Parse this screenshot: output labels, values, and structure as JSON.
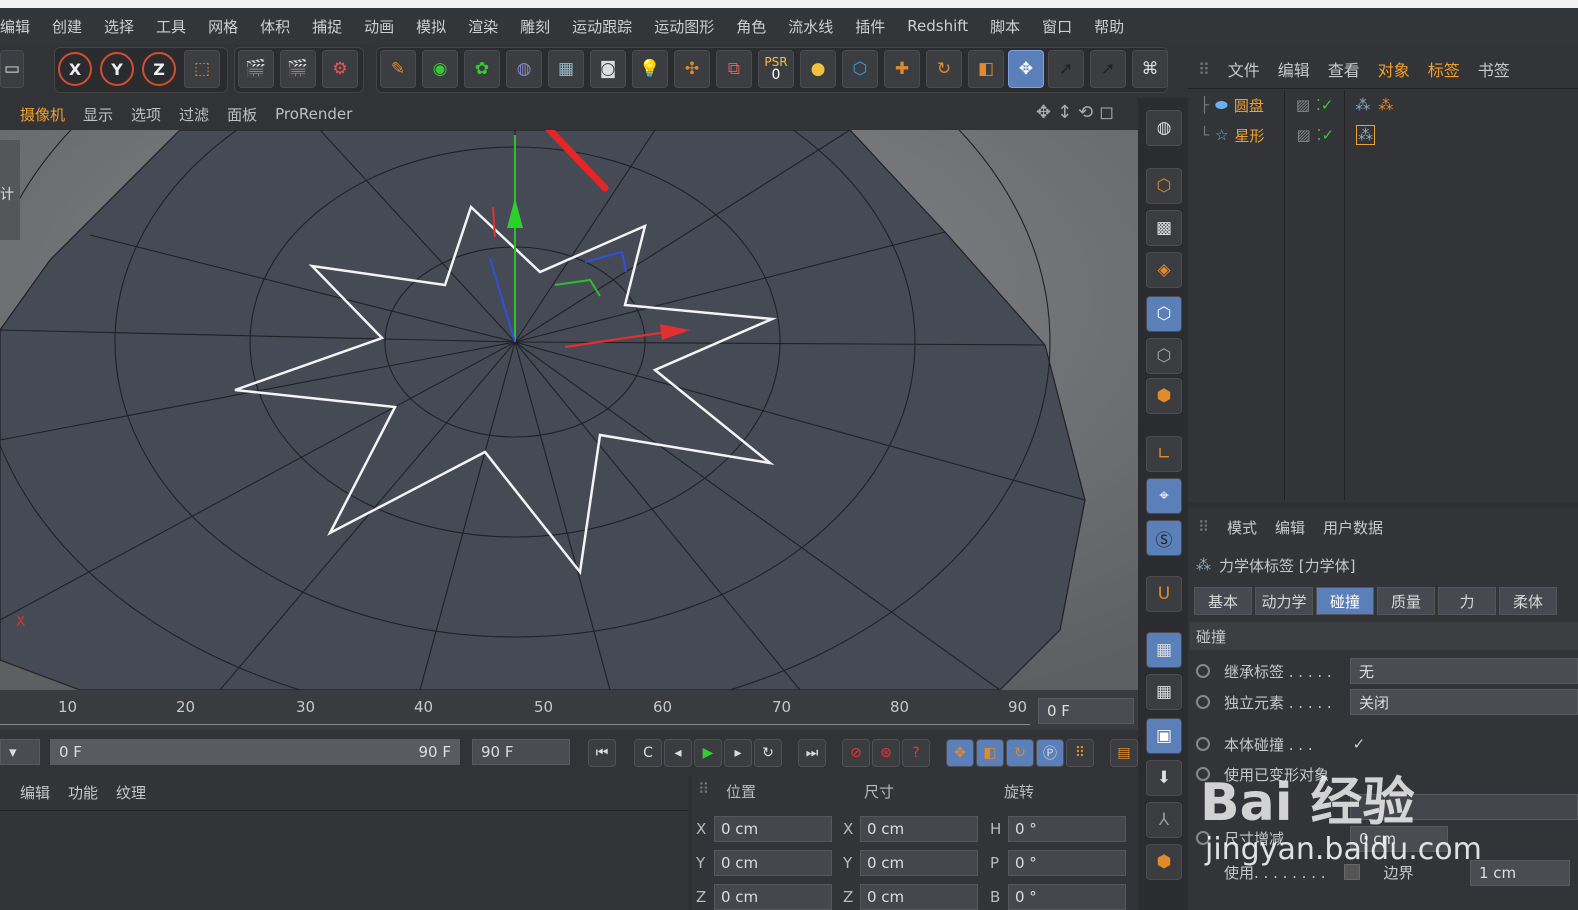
{
  "menubar": [
    "编辑",
    "创建",
    "选择",
    "工具",
    "网格",
    "体积",
    "捕捉",
    "动画",
    "模拟",
    "渲染",
    "雕刻",
    "运动跟踪",
    "运动图形",
    "角色",
    "流水线",
    "插件",
    "Redshift",
    "脚本",
    "窗口",
    "帮助"
  ],
  "toolbar": {
    "axis_x": "X",
    "axis_y": "Y",
    "axis_z": "Z",
    "psr_label": "PSR",
    "psr_value": "0"
  },
  "viewmenu": {
    "items": [
      "摄像机",
      "显示",
      "选项",
      "过滤",
      "面板",
      "ProRender"
    ]
  },
  "left_edge_label": "计",
  "objects": {
    "menu": [
      "文件",
      "编辑",
      "查看",
      "对象",
      "标签",
      "书签"
    ],
    "items": [
      {
        "name": "圆盘"
      },
      {
        "name": "星形"
      }
    ]
  },
  "attributes": {
    "menu": [
      "模式",
      "编辑",
      "用户数据"
    ],
    "title": "力学体标签 [力学体]",
    "tabs": [
      "基本",
      "动力学",
      "碰撞",
      "质量",
      "力",
      "柔体"
    ],
    "active_tab": "碰撞",
    "section": "碰撞",
    "rows": [
      {
        "label": "继承标签 . . . . .",
        "value": "无"
      },
      {
        "label": "独立元素 . . . . .",
        "value": "关闭"
      },
      {
        "label": "本体碰撞 . . .",
        "value": ""
      },
      {
        "label": "使用已变形对象",
        "value": ""
      },
      {
        "label": "尺寸增减",
        "value": "0 cm"
      },
      {
        "label": "使用. . . . . . . .",
        "value": ""
      }
    ],
    "border_label": "边界",
    "border_value": "1 cm"
  },
  "timeline": {
    "ticks": [
      "10",
      "20",
      "30",
      "40",
      "50",
      "60",
      "70",
      "80",
      "90"
    ],
    "frame": "0 F"
  },
  "transport": {
    "start": "0 F",
    "end_in_slider": "90 F",
    "end": "90 F"
  },
  "material_menu": [
    "编辑",
    "功能",
    "纹理"
  ],
  "coords": {
    "headers": [
      "位置",
      "尺寸",
      "旋转"
    ],
    "pos": {
      "x": "0 cm",
      "y": "0 cm",
      "z": "0 cm"
    },
    "size": {
      "x": "0 cm",
      "y": "0 cm",
      "z": "0 cm"
    },
    "rot": {
      "h": "0 °",
      "p": "0 °",
      "b": "0 °"
    },
    "axis_labels": {
      "x": "X",
      "y": "Y",
      "z": "Z",
      "h": "H",
      "p": "P",
      "b": "B"
    }
  },
  "watermark": {
    "brand": "Bai  经验",
    "url": "jingyan.baidu.com"
  },
  "viewport": {
    "axis_label": "X"
  }
}
